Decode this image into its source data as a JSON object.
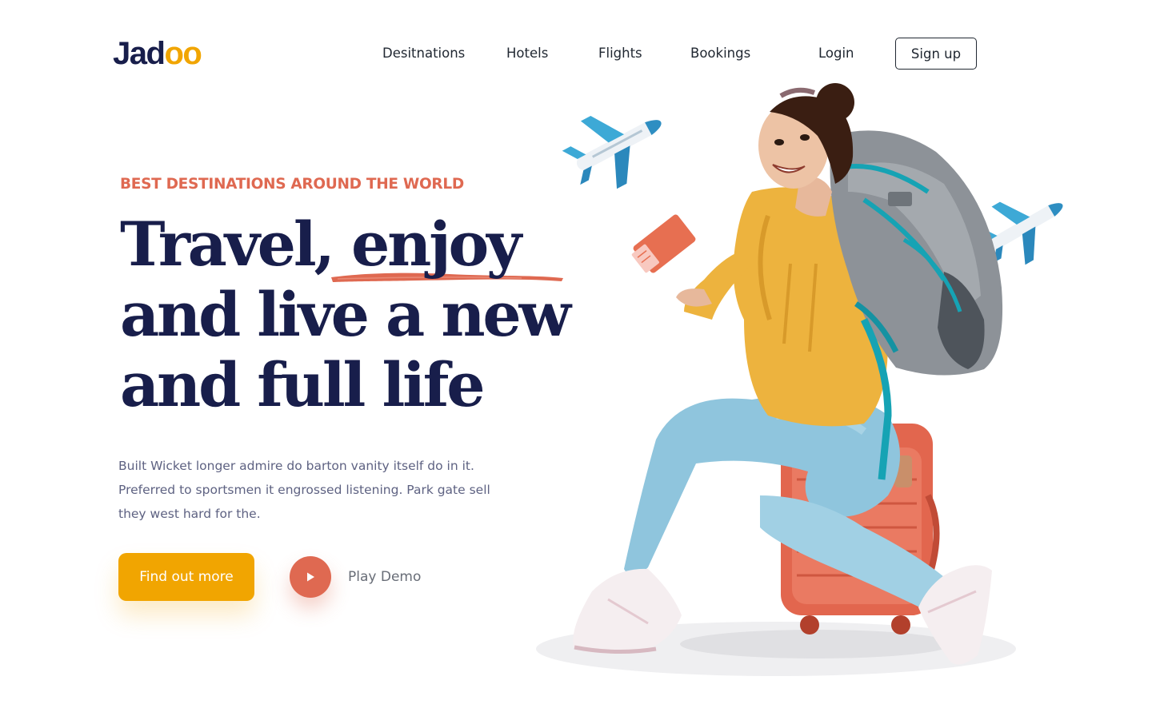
{
  "brand": {
    "logo_main": "Jad",
    "logo_accent": "oo"
  },
  "nav": {
    "items": [
      {
        "label": "Desitnations"
      },
      {
        "label": "Hotels"
      },
      {
        "label": "Flights"
      },
      {
        "label": "Bookings"
      }
    ],
    "login_label": "Login",
    "signup_label": "Sign up"
  },
  "hero": {
    "eyebrow": "BEST DESTINATIONS AROUND THE WORLD",
    "headline": {
      "line1_a": "Travel, ",
      "line1_b": "enjoy",
      "line2": "and live a new",
      "line3": "and full life"
    },
    "description": "Built Wicket longer admire do barton vanity itself do in it. Preferred to sportsmen it engrossed listening. Park gate sell they west hard for the.",
    "cta_label": "Find out more",
    "play_label": "Play Demo"
  },
  "colors": {
    "primary": "#181E4B",
    "accent_orange": "#DF6951",
    "accent_yellow": "#F1A501",
    "text_muted": "#5E6282"
  },
  "icons": {
    "play": "play-icon",
    "airplane": "airplane-icon"
  }
}
